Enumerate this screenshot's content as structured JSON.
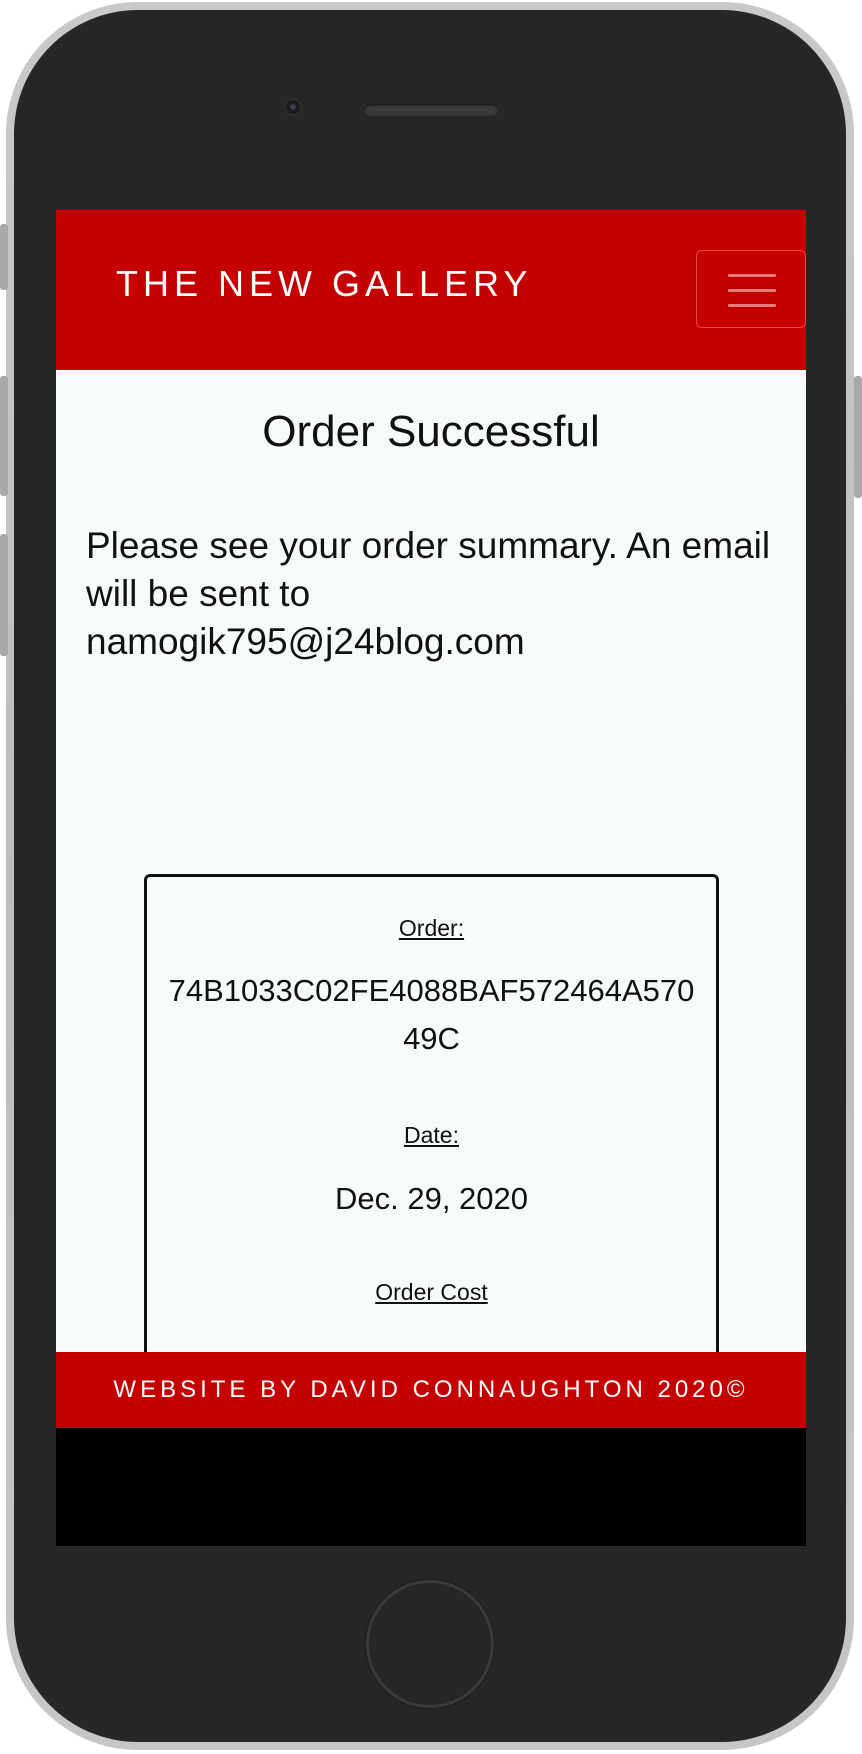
{
  "navbar": {
    "brand": "THE NEW GALLERY",
    "toggle_icon": "hamburger-menu-icon",
    "background_color": "#c40000"
  },
  "page": {
    "title": "Order Successful",
    "summary_line": "Please see your order summary. An email will be sent to",
    "email": "namogik795@j24blog.com"
  },
  "order_card": {
    "order_label": "Order:",
    "order_number": "74B1033C02FE4088BAF572464A57049C",
    "date_label": "Date:",
    "date_value": "Dec. 29, 2020",
    "cost_label": "Order Cost"
  },
  "footer": {
    "text": "WEBSITE BY DAVID CONNAUGHTON 2020©"
  }
}
